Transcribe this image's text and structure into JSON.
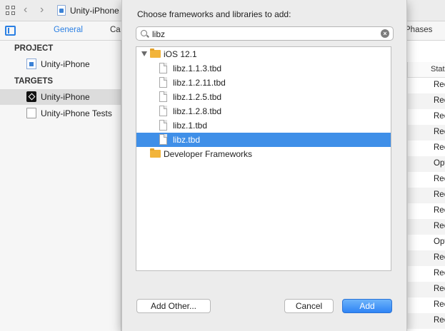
{
  "toolbar": {
    "title": "Unity-iPhone"
  },
  "tabs": {
    "general": "General",
    "capabilities_partial": "Ca",
    "build_phases_partial": "Phases"
  },
  "sidebar": {
    "project_header": "PROJECT",
    "project_item": "Unity-iPhone",
    "targets_header": "TARGETS",
    "targets": [
      {
        "label": "Unity-iPhone",
        "icon": "unity-app-icon",
        "selected": true
      },
      {
        "label": "Unity-iPhone Tests",
        "icon": "test-bundle-icon",
        "selected": false
      }
    ]
  },
  "status_column": {
    "header": "Stat",
    "rows": [
      "Rec",
      "Rec",
      "Rec",
      "Rec",
      "Rec",
      "Opt",
      "Rec",
      "Rec",
      "Rec",
      "Rec",
      "Opt",
      "Rec",
      "Rec",
      "Rec",
      "Rec",
      "Rec"
    ]
  },
  "dialog": {
    "title": "Choose frameworks and libraries to add:",
    "search": {
      "value": "libz",
      "placeholder": ""
    },
    "tree": {
      "group": "iOS 12.1",
      "files": [
        "libz.1.1.3.tbd",
        "libz.1.2.11.tbd",
        "libz.1.2.5.tbd",
        "libz.1.2.8.tbd",
        "libz.1.tbd",
        "libz.tbd"
      ],
      "selected_file": "libz.tbd",
      "folder": "Developer Frameworks"
    },
    "buttons": {
      "add_other": "Add Other...",
      "cancel": "Cancel",
      "add": "Add"
    }
  },
  "colors": {
    "accent": "#2a7fe3",
    "selection": "#3f8fe8",
    "folder": "#f2b43a"
  }
}
